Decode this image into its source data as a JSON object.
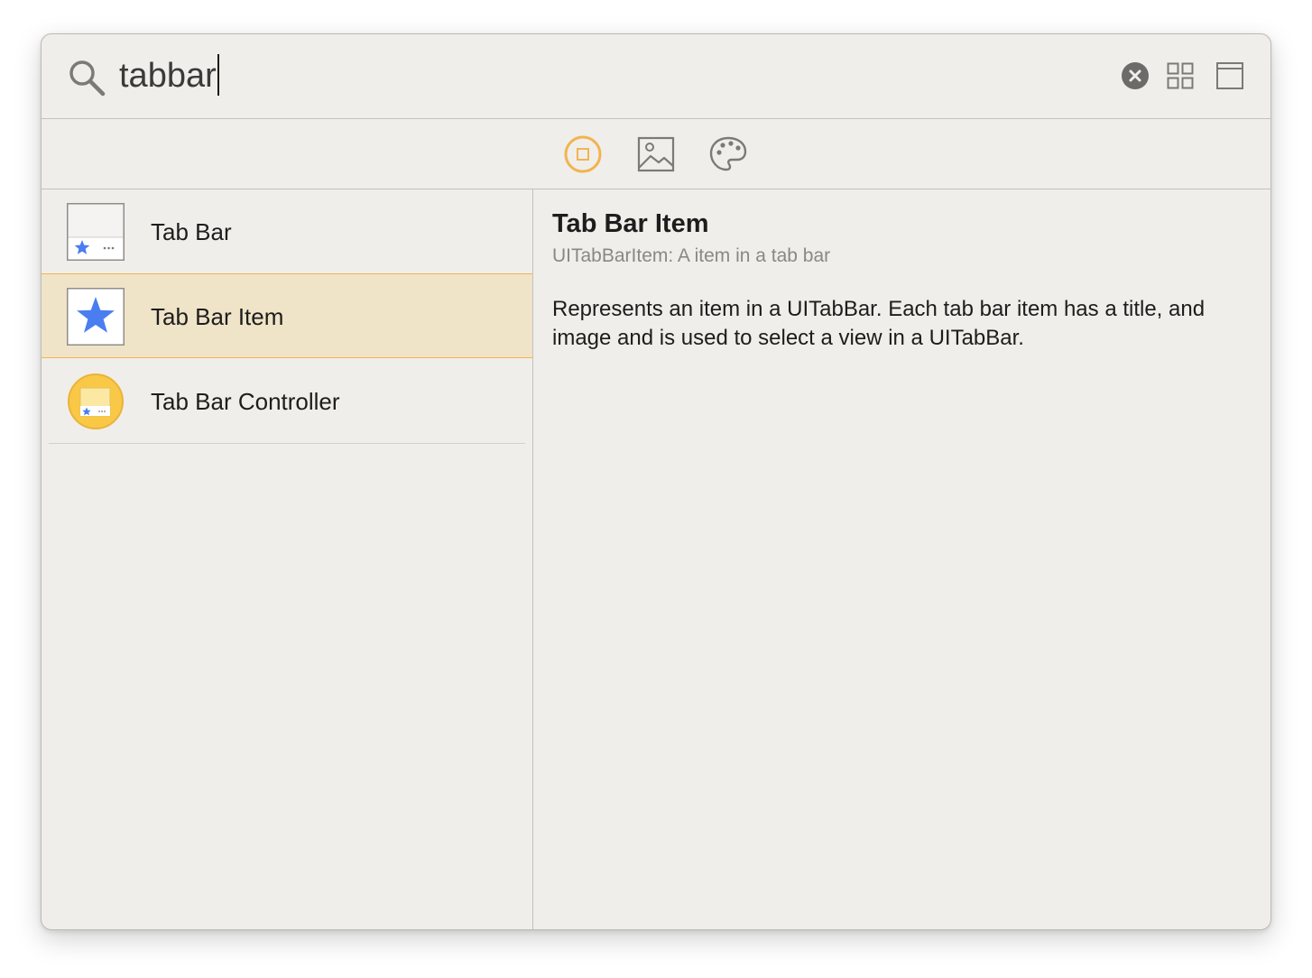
{
  "search": {
    "query": "tabbar"
  },
  "icons": {
    "search": "magnifier-icon",
    "clear": "clear-circle-x-icon",
    "grid": "grid-view-icon",
    "panel": "panel-layout-icon",
    "filter_objects": "object-library-icon",
    "filter_media": "image-icon",
    "filter_colors": "palette-icon"
  },
  "colors": {
    "accent": "#f2b44f",
    "selected_row": "#f0e4c8",
    "star_blue": "#4a7df0",
    "controller_yellow": "#f9c846"
  },
  "library": {
    "items": [
      {
        "label": "Tab Bar",
        "icon": "tab-bar-thumbnail-icon"
      },
      {
        "label": "Tab Bar Item",
        "icon": "star-thumbnail-icon"
      },
      {
        "label": "Tab Bar Controller",
        "icon": "tab-bar-controller-thumbnail-icon"
      }
    ],
    "selected_index": 1
  },
  "detail": {
    "title": "Tab Bar Item",
    "subtitle": "UITabBarItem: A item in a tab bar",
    "description": "Represents an item in a UITabBar. Each tab bar item has a title, and image and is used to select a view in a UITabBar."
  }
}
